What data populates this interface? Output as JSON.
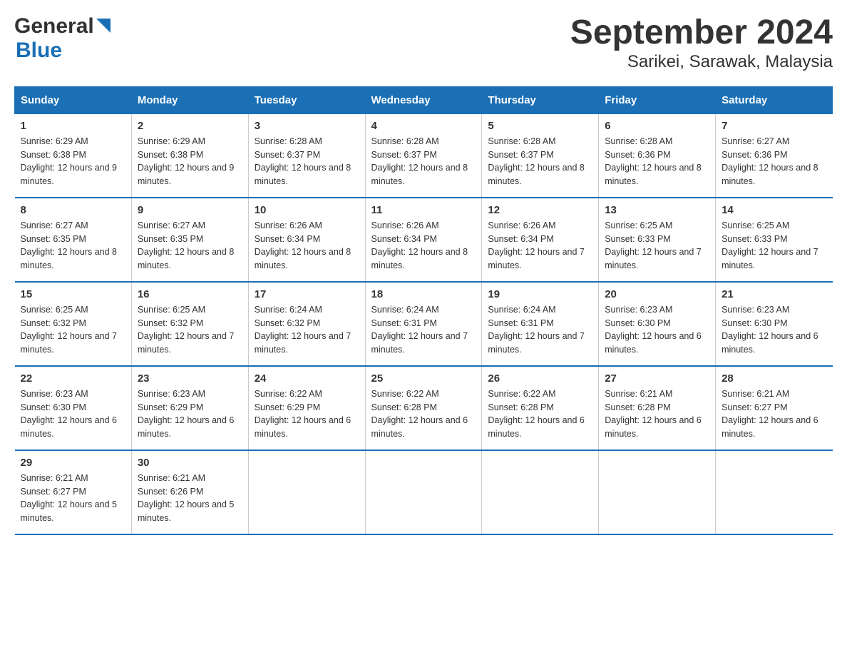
{
  "logo": {
    "general": "General",
    "blue": "Blue",
    "tagline": ""
  },
  "title": "September 2024",
  "subtitle": "Sarikei, Sarawak, Malaysia",
  "days_of_week": [
    "Sunday",
    "Monday",
    "Tuesday",
    "Wednesday",
    "Thursday",
    "Friday",
    "Saturday"
  ],
  "weeks": [
    [
      {
        "num": "1",
        "sunrise": "6:29 AM",
        "sunset": "6:38 PM",
        "daylight": "12 hours and 9 minutes."
      },
      {
        "num": "2",
        "sunrise": "6:29 AM",
        "sunset": "6:38 PM",
        "daylight": "12 hours and 9 minutes."
      },
      {
        "num": "3",
        "sunrise": "6:28 AM",
        "sunset": "6:37 PM",
        "daylight": "12 hours and 8 minutes."
      },
      {
        "num": "4",
        "sunrise": "6:28 AM",
        "sunset": "6:37 PM",
        "daylight": "12 hours and 8 minutes."
      },
      {
        "num": "5",
        "sunrise": "6:28 AM",
        "sunset": "6:37 PM",
        "daylight": "12 hours and 8 minutes."
      },
      {
        "num": "6",
        "sunrise": "6:28 AM",
        "sunset": "6:36 PM",
        "daylight": "12 hours and 8 minutes."
      },
      {
        "num": "7",
        "sunrise": "6:27 AM",
        "sunset": "6:36 PM",
        "daylight": "12 hours and 8 minutes."
      }
    ],
    [
      {
        "num": "8",
        "sunrise": "6:27 AM",
        "sunset": "6:35 PM",
        "daylight": "12 hours and 8 minutes."
      },
      {
        "num": "9",
        "sunrise": "6:27 AM",
        "sunset": "6:35 PM",
        "daylight": "12 hours and 8 minutes."
      },
      {
        "num": "10",
        "sunrise": "6:26 AM",
        "sunset": "6:34 PM",
        "daylight": "12 hours and 8 minutes."
      },
      {
        "num": "11",
        "sunrise": "6:26 AM",
        "sunset": "6:34 PM",
        "daylight": "12 hours and 8 minutes."
      },
      {
        "num": "12",
        "sunrise": "6:26 AM",
        "sunset": "6:34 PM",
        "daylight": "12 hours and 7 minutes."
      },
      {
        "num": "13",
        "sunrise": "6:25 AM",
        "sunset": "6:33 PM",
        "daylight": "12 hours and 7 minutes."
      },
      {
        "num": "14",
        "sunrise": "6:25 AM",
        "sunset": "6:33 PM",
        "daylight": "12 hours and 7 minutes."
      }
    ],
    [
      {
        "num": "15",
        "sunrise": "6:25 AM",
        "sunset": "6:32 PM",
        "daylight": "12 hours and 7 minutes."
      },
      {
        "num": "16",
        "sunrise": "6:25 AM",
        "sunset": "6:32 PM",
        "daylight": "12 hours and 7 minutes."
      },
      {
        "num": "17",
        "sunrise": "6:24 AM",
        "sunset": "6:32 PM",
        "daylight": "12 hours and 7 minutes."
      },
      {
        "num": "18",
        "sunrise": "6:24 AM",
        "sunset": "6:31 PM",
        "daylight": "12 hours and 7 minutes."
      },
      {
        "num": "19",
        "sunrise": "6:24 AM",
        "sunset": "6:31 PM",
        "daylight": "12 hours and 7 minutes."
      },
      {
        "num": "20",
        "sunrise": "6:23 AM",
        "sunset": "6:30 PM",
        "daylight": "12 hours and 6 minutes."
      },
      {
        "num": "21",
        "sunrise": "6:23 AM",
        "sunset": "6:30 PM",
        "daylight": "12 hours and 6 minutes."
      }
    ],
    [
      {
        "num": "22",
        "sunrise": "6:23 AM",
        "sunset": "6:30 PM",
        "daylight": "12 hours and 6 minutes."
      },
      {
        "num": "23",
        "sunrise": "6:23 AM",
        "sunset": "6:29 PM",
        "daylight": "12 hours and 6 minutes."
      },
      {
        "num": "24",
        "sunrise": "6:22 AM",
        "sunset": "6:29 PM",
        "daylight": "12 hours and 6 minutes."
      },
      {
        "num": "25",
        "sunrise": "6:22 AM",
        "sunset": "6:28 PM",
        "daylight": "12 hours and 6 minutes."
      },
      {
        "num": "26",
        "sunrise": "6:22 AM",
        "sunset": "6:28 PM",
        "daylight": "12 hours and 6 minutes."
      },
      {
        "num": "27",
        "sunrise": "6:21 AM",
        "sunset": "6:28 PM",
        "daylight": "12 hours and 6 minutes."
      },
      {
        "num": "28",
        "sunrise": "6:21 AM",
        "sunset": "6:27 PM",
        "daylight": "12 hours and 6 minutes."
      }
    ],
    [
      {
        "num": "29",
        "sunrise": "6:21 AM",
        "sunset": "6:27 PM",
        "daylight": "12 hours and 5 minutes."
      },
      {
        "num": "30",
        "sunrise": "6:21 AM",
        "sunset": "6:26 PM",
        "daylight": "12 hours and 5 minutes."
      },
      null,
      null,
      null,
      null,
      null
    ]
  ]
}
